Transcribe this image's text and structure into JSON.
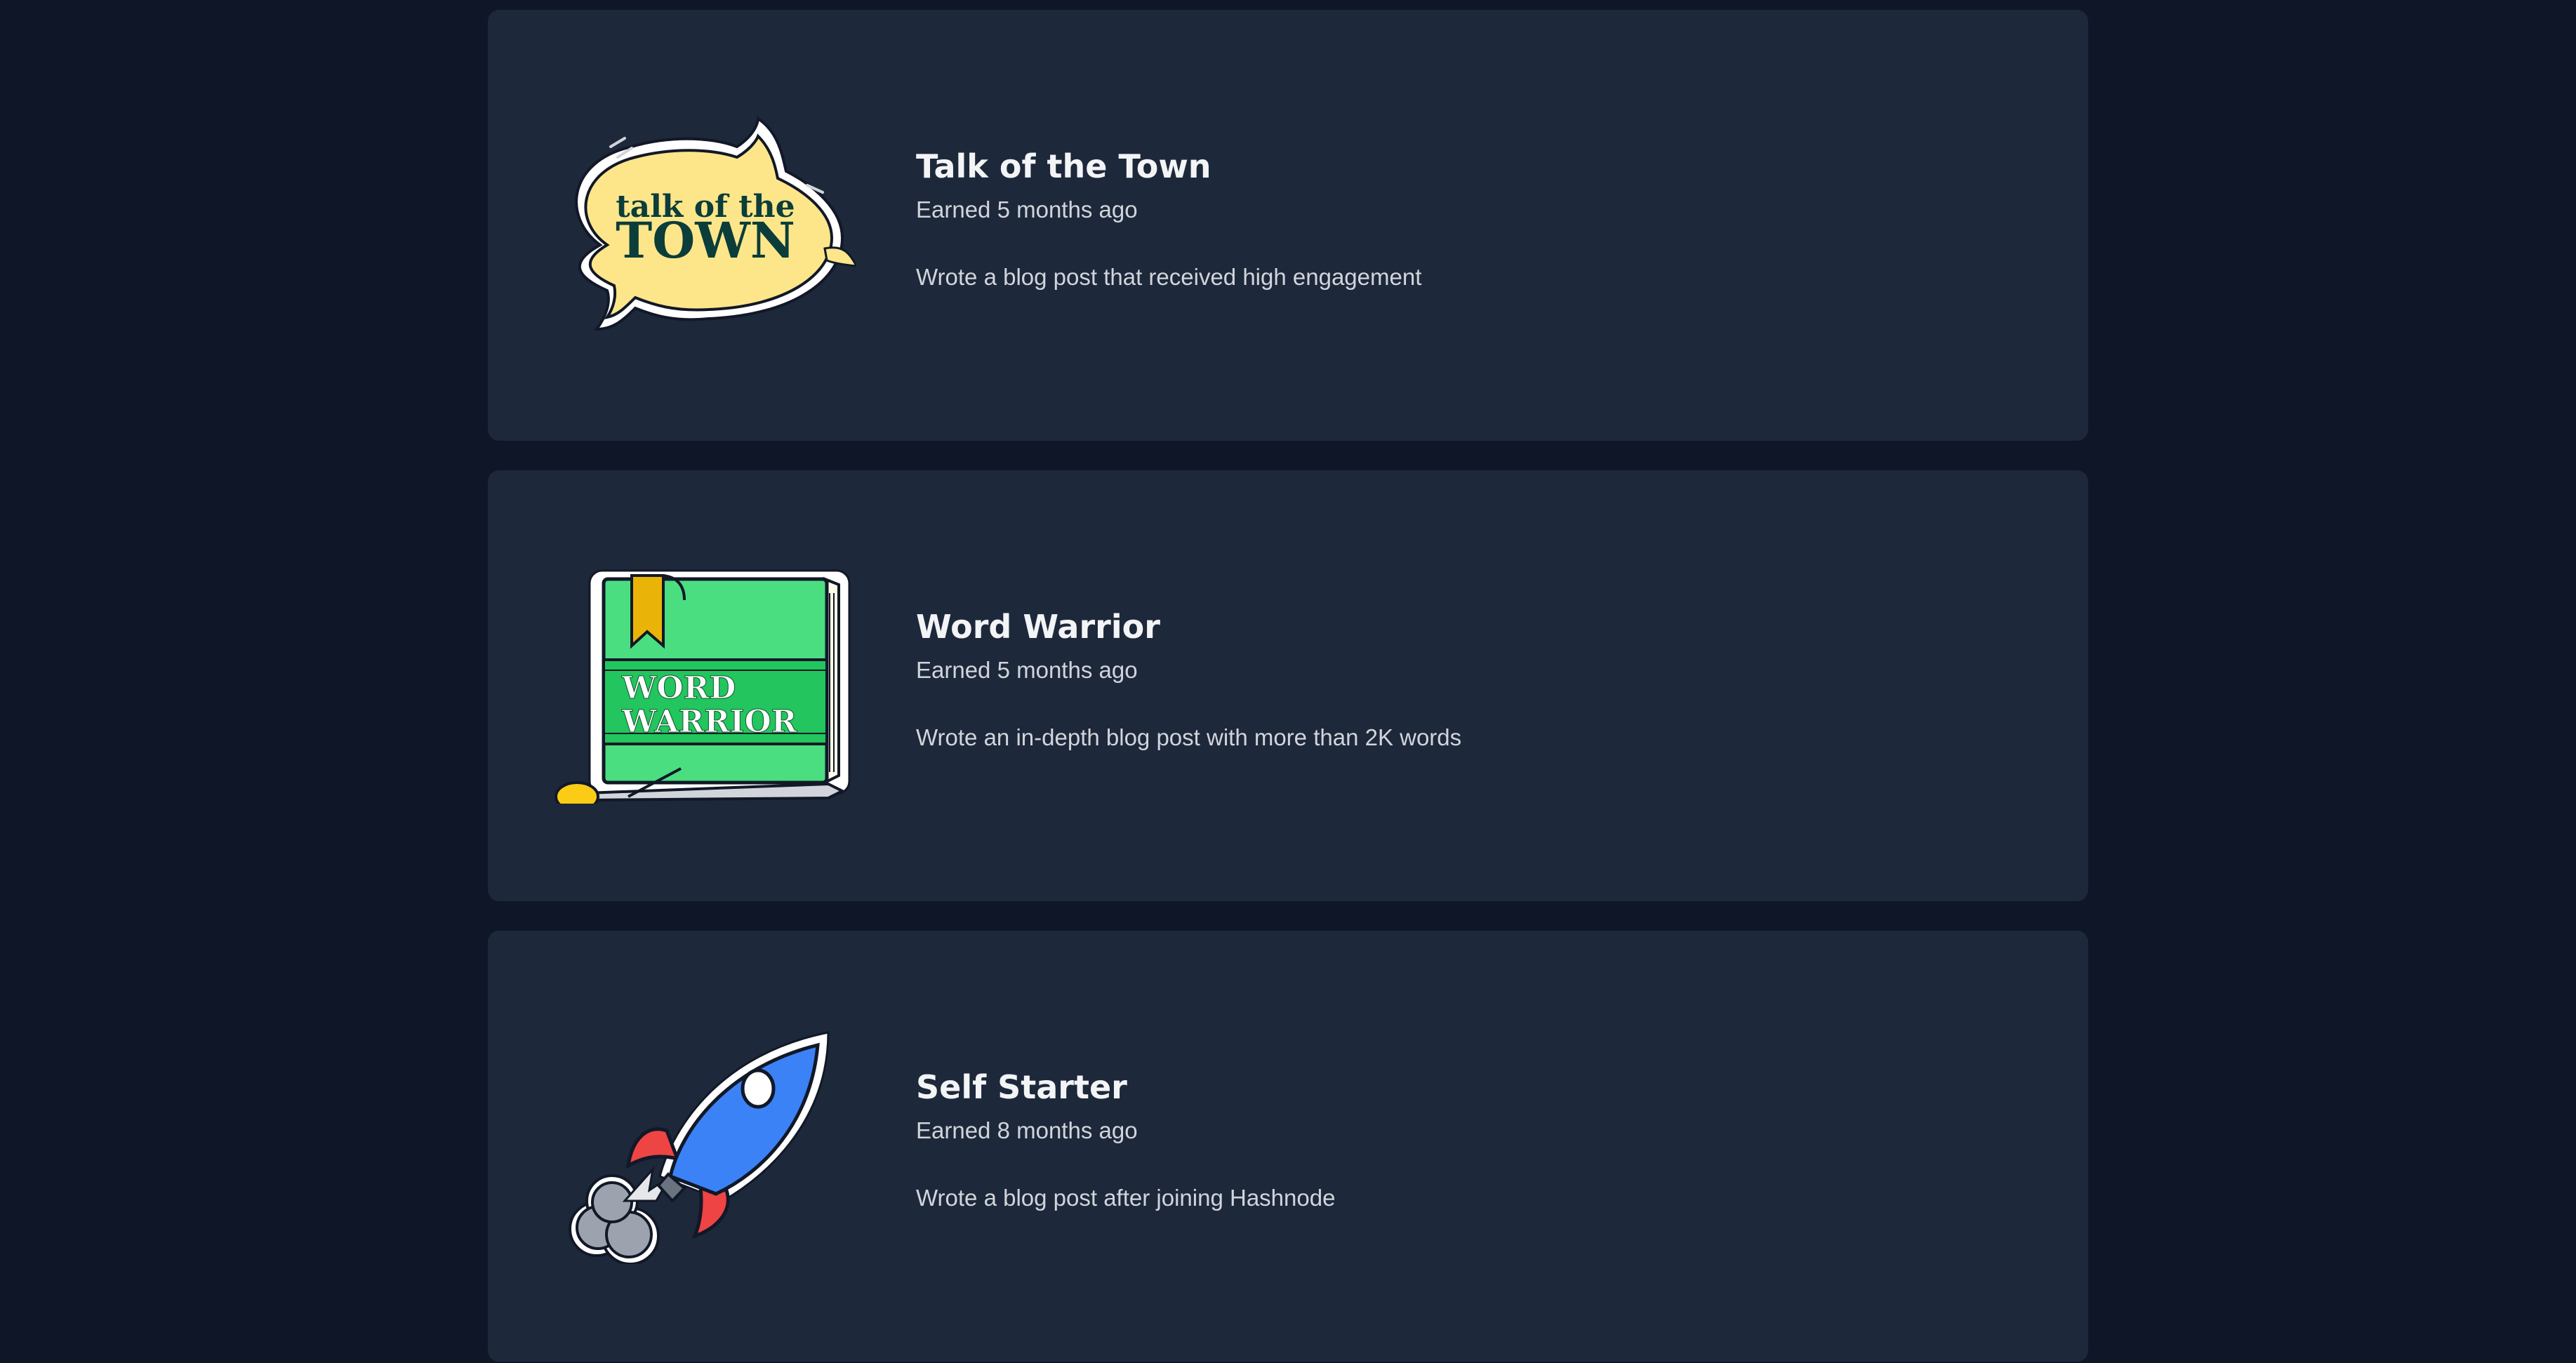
{
  "badges": [
    {
      "title": "Talk of the Town",
      "earned": "Earned 5 months ago",
      "description": "Wrote a blog post that received high engagement",
      "icon": "talk-of-the-town-badge-icon",
      "art_text_line1": "talk of the",
      "art_text_line2": "TOWN"
    },
    {
      "title": "Word Warrior",
      "earned": "Earned 5 months ago",
      "description": "Wrote an in-depth blog post with more than 2K words",
      "icon": "word-warrior-badge-icon",
      "art_text_line1": "WORD",
      "art_text_line2": "WARRIOR"
    },
    {
      "title": "Self Starter",
      "earned": "Earned 8 months ago",
      "description": "Wrote a blog post after joining Hashnode",
      "icon": "self-starter-rocket-icon"
    }
  ],
  "colors": {
    "page_background": "#0e1628",
    "card_background": "#1e283b",
    "title_text": "#f3f4f6",
    "body_text": "#d1d5db"
  }
}
